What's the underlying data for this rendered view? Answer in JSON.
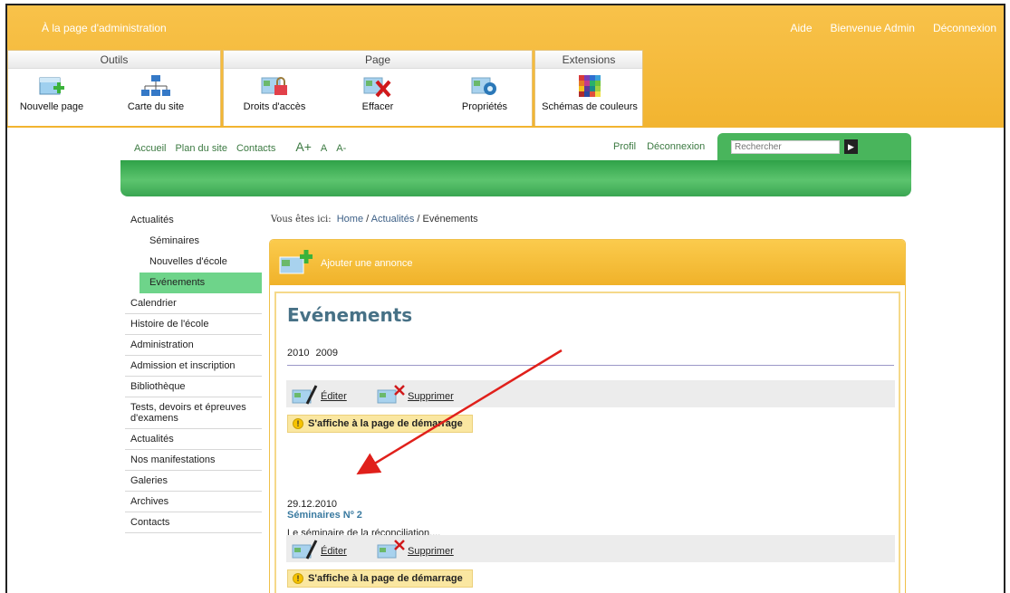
{
  "admin": {
    "back_link": "À la page d'administration",
    "top_links": [
      "Aide",
      "Bienvenue Admin",
      "Déconnexion"
    ],
    "groups": [
      {
        "title": "Outils",
        "tools": [
          "Nouvelle page",
          "Carte du site"
        ]
      },
      {
        "title": "Page",
        "tools": [
          "Droits d'accès",
          "Effacer",
          "Propriétés"
        ]
      },
      {
        "title": "Extensions",
        "tools": [
          "Schémas de couleurs"
        ]
      }
    ]
  },
  "site_nav": {
    "left": [
      "Accueil",
      "Plan du site",
      "Contacts"
    ],
    "font_sizes": [
      "A+",
      "A",
      "A-"
    ],
    "right": [
      "Profil",
      "Déconnexion"
    ],
    "search_placeholder": "Rechercher"
  },
  "sidebar": {
    "items": [
      {
        "label": "Actualités",
        "level": "top"
      },
      {
        "label": "Séminaires",
        "level": "sub"
      },
      {
        "label": "Nouvelles d'école",
        "level": "sub"
      },
      {
        "label": "Evénements",
        "level": "sub",
        "active": true
      },
      {
        "label": "Calendrier"
      },
      {
        "label": "Histoire de l'école"
      },
      {
        "label": "Administration"
      },
      {
        "label": "Admission et inscription"
      },
      {
        "label": "Bibliothèque"
      },
      {
        "label": "Tests, devoirs et épreuves d'examens"
      },
      {
        "label": "Actualités"
      },
      {
        "label": "Nos manifestations"
      },
      {
        "label": "Galeries"
      },
      {
        "label": "Archives"
      },
      {
        "label": "Contacts"
      }
    ]
  },
  "breadcrumb": {
    "label": "Vous êtes ici:",
    "items": [
      "Home",
      "Actualités",
      "Evénements"
    ],
    "separator": " / "
  },
  "panel": {
    "add_label": "Ajouter une annonce",
    "title": "Evénements",
    "years": [
      "2010",
      "2009"
    ],
    "edit_label": "Éditer",
    "delete_label": "Supprimer",
    "notice": "S'affiche à la page de démarrage",
    "entry": {
      "date": "29.12.2010",
      "title": "Séminaires Nº 2",
      "text": "Le séminaire de la réconciliation...."
    }
  },
  "colors": {
    "admin_bar": "#f4b936",
    "green": "#49b55c",
    "title_blue": "#477186",
    "arrow": "#e0201b"
  }
}
